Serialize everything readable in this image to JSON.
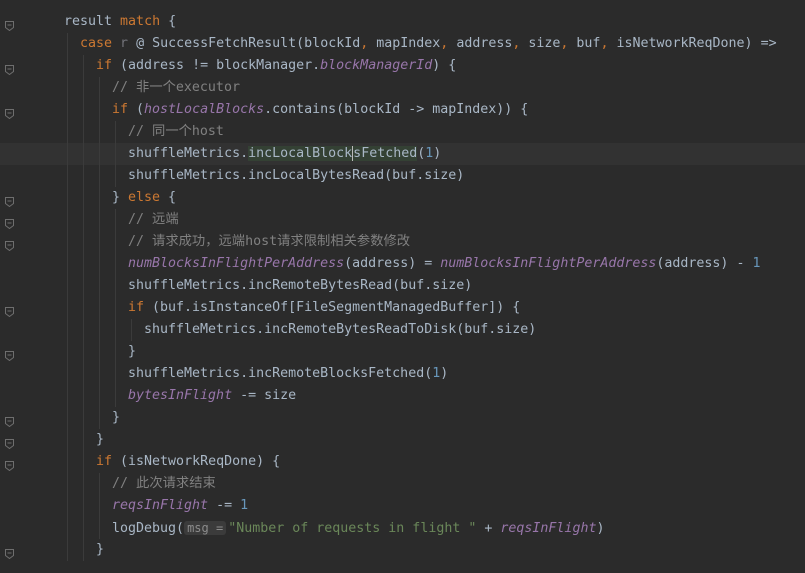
{
  "editor": {
    "colors": {
      "background": "#2b2b2b",
      "text": "#a9b7c6",
      "keyword": "#cc7832",
      "comment": "#808080",
      "field": "#9876aa",
      "number": "#6897bb",
      "string": "#6a8759"
    },
    "lines": [
      {
        "indent": 0,
        "fold": true,
        "tokens": [
          [
            "result ",
            ""
          ],
          [
            "match",
            "kw"
          ],
          [
            " {",
            ""
          ]
        ]
      },
      {
        "indent": 1,
        "tokens": [
          [
            "case",
            "kw"
          ],
          [
            " ",
            ""
          ],
          [
            "r",
            "unused"
          ],
          [
            " @ SuccessFetchResult(blockId",
            ""
          ],
          [
            ", ",
            "kw"
          ],
          [
            "mapIndex",
            ""
          ],
          [
            ", ",
            "kw"
          ],
          [
            "address",
            ""
          ],
          [
            ", ",
            "kw"
          ],
          [
            "size",
            ""
          ],
          [
            ", ",
            "kw"
          ],
          [
            "buf",
            ""
          ],
          [
            ", ",
            "kw"
          ],
          [
            "isNetworkReqDone) =>",
            ""
          ]
        ]
      },
      {
        "indent": 2,
        "fold": true,
        "tokens": [
          [
            "if",
            "kw"
          ],
          [
            " (address != blockManager.",
            ""
          ],
          [
            "blockManagerId",
            "fld"
          ],
          [
            ") {",
            ""
          ]
        ]
      },
      {
        "indent": 3,
        "tokens": [
          [
            "// 非一个executor",
            "cm"
          ]
        ]
      },
      {
        "indent": 3,
        "fold": true,
        "tokens": [
          [
            "if",
            "kw"
          ],
          [
            " (",
            ""
          ],
          [
            "hostLocalBlocks",
            "fld"
          ],
          [
            ".contains(blockId -> mapIndex)) {",
            ""
          ]
        ]
      },
      {
        "indent": 4,
        "tokens": [
          [
            "// 同一个host",
            "cm"
          ]
        ]
      },
      {
        "indent": 4,
        "current": true,
        "tokens": [
          [
            "shuffleMetrics.",
            ""
          ],
          [
            "incLocalBlock",
            "hl"
          ],
          [
            "s",
            "hl caret"
          ],
          [
            "Fetched",
            "hl"
          ],
          [
            "(",
            ""
          ],
          [
            "1",
            "num"
          ],
          [
            ")",
            ""
          ]
        ]
      },
      {
        "indent": 4,
        "tokens": [
          [
            "shuffleMetrics.incLocalBytesRead(buf.size)",
            ""
          ]
        ]
      },
      {
        "indent": 3,
        "fold": true,
        "tokens": [
          [
            "} ",
            ""
          ],
          [
            "else",
            "kw"
          ],
          [
            " {",
            ""
          ]
        ]
      },
      {
        "indent": 4,
        "fold": true,
        "tokens": [
          [
            "// 远端",
            "cm"
          ]
        ]
      },
      {
        "indent": 4,
        "fold": true,
        "tokens": [
          [
            "// 请求成功，远端host请求限制相关参数修改",
            "cm"
          ]
        ]
      },
      {
        "indent": 4,
        "tokens": [
          [
            "numBlocksInFlightPerAddress",
            "fld"
          ],
          [
            "(address) = ",
            ""
          ],
          [
            "numBlocksInFlightPerAddress",
            "fld"
          ],
          [
            "(address) - ",
            ""
          ],
          [
            "1",
            "num"
          ]
        ]
      },
      {
        "indent": 4,
        "tokens": [
          [
            "shuffleMetrics.incRemoteBytesRead(buf.size)",
            ""
          ]
        ]
      },
      {
        "indent": 4,
        "fold": true,
        "tokens": [
          [
            "if",
            "kw"
          ],
          [
            " (buf.isInstanceOf[FileSegmentManagedBuffer]) {",
            ""
          ]
        ]
      },
      {
        "indent": 5,
        "tokens": [
          [
            "shuffleMetrics.incRemoteBytesReadToDisk(buf.size)",
            ""
          ]
        ]
      },
      {
        "indent": 4,
        "fold": true,
        "tokens": [
          [
            "}",
            ""
          ]
        ]
      },
      {
        "indent": 4,
        "tokens": [
          [
            "shuffleMetrics.incRemoteBlocksFetched(",
            ""
          ],
          [
            "1",
            "num"
          ],
          [
            ")",
            ""
          ]
        ]
      },
      {
        "indent": 4,
        "tokens": [
          [
            "bytesInFlight",
            "fld"
          ],
          [
            " -= size",
            ""
          ]
        ]
      },
      {
        "indent": 3,
        "fold": true,
        "tokens": [
          [
            "}",
            ""
          ]
        ]
      },
      {
        "indent": 2,
        "fold": true,
        "tokens": [
          [
            "}",
            ""
          ]
        ]
      },
      {
        "indent": 2,
        "fold": true,
        "tokens": [
          [
            "if",
            "kw"
          ],
          [
            " (isNetworkReqDone) {",
            ""
          ]
        ]
      },
      {
        "indent": 3,
        "tokens": [
          [
            "// 此次请求结束",
            "cm"
          ]
        ]
      },
      {
        "indent": 3,
        "tokens": [
          [
            "reqsInFlight",
            "fld"
          ],
          [
            " -= ",
            ""
          ],
          [
            "1",
            "num"
          ]
        ]
      },
      {
        "indent": 3,
        "tokens": [
          [
            "logDebug(",
            ""
          ],
          [
            "msg =",
            "hint"
          ],
          [
            "\"Number of requests in flight \"",
            "str"
          ],
          [
            " + ",
            ""
          ],
          [
            "reqsInFlight",
            "fld"
          ],
          [
            ")",
            ""
          ]
        ]
      },
      {
        "indent": 2,
        "fold": true,
        "tokens": [
          [
            "}",
            ""
          ]
        ]
      }
    ]
  }
}
